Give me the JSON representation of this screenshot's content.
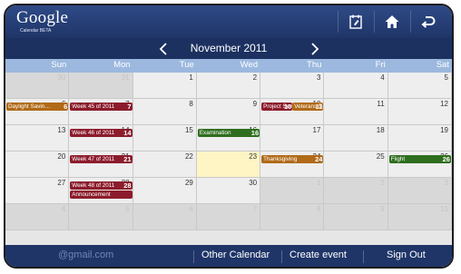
{
  "app": {
    "logo_text": "Google",
    "logo_sub": "Calendar BETA"
  },
  "toolbar": {
    "icons": [
      "edit-calendar-icon",
      "home-icon",
      "back-icon"
    ]
  },
  "calendar": {
    "month_label": "November 2011",
    "weekdays": [
      "Sun",
      "Mon",
      "Tue",
      "Wed",
      "Thu",
      "Fri",
      "Sat"
    ],
    "weeks": [
      [
        {
          "d": "30",
          "o": true
        },
        {
          "d": "31",
          "o": true
        },
        {
          "d": "1"
        },
        {
          "d": "2"
        },
        {
          "d": "3"
        },
        {
          "d": "4"
        },
        {
          "d": "5"
        }
      ],
      [
        {
          "d": "6"
        },
        {
          "d": "7"
        },
        {
          "d": "8"
        },
        {
          "d": "9"
        },
        {
          "d": "10"
        },
        {
          "d": "11"
        },
        {
          "d": "12"
        }
      ],
      [
        {
          "d": "13"
        },
        {
          "d": "14"
        },
        {
          "d": "15"
        },
        {
          "d": "16"
        },
        {
          "d": "17"
        },
        {
          "d": "18"
        },
        {
          "d": "19"
        }
      ],
      [
        {
          "d": "20"
        },
        {
          "d": "21"
        },
        {
          "d": "22"
        },
        {
          "d": "23",
          "t": true
        },
        {
          "d": "24"
        },
        {
          "d": "25"
        },
        {
          "d": "26"
        }
      ],
      [
        {
          "d": "27"
        },
        {
          "d": "28"
        },
        {
          "d": "29"
        },
        {
          "d": "30"
        },
        {
          "d": "1",
          "o": true
        },
        {
          "d": "2",
          "o": true
        },
        {
          "d": "3",
          "o": true
        }
      ],
      [
        {
          "d": "4",
          "o": true
        },
        {
          "d": "5",
          "o": true
        },
        {
          "d": "6",
          "o": true
        },
        {
          "d": "7",
          "o": true
        },
        {
          "d": "8",
          "o": true
        },
        {
          "d": "9",
          "o": true
        },
        {
          "d": "10",
          "o": true
        }
      ]
    ],
    "events": [
      {
        "title": "Daylight Savin…",
        "count": "6",
        "week": 1,
        "day": 0,
        "color": "#b06a18"
      },
      {
        "title": "Week 45 of 2011",
        "count": "7",
        "week": 1,
        "day": 1,
        "color": "#8c1c2c"
      },
      {
        "title": "Project Seminar",
        "count": "10",
        "week": 1,
        "day": 4,
        "color": "#8c1c2c",
        "half": "left"
      },
      {
        "title": "Veterans Day",
        "count": "11",
        "week": 1,
        "day": 4,
        "color": "#b06a18",
        "half": "right"
      },
      {
        "title": "Week 46 of 2011",
        "count": "14",
        "week": 2,
        "day": 1,
        "color": "#8c1c2c"
      },
      {
        "title": "Examination",
        "count": "16",
        "week": 2,
        "day": 3,
        "color": "#2f6e1e"
      },
      {
        "title": "Week 47 of 2011",
        "count": "21",
        "week": 3,
        "day": 1,
        "color": "#8c1c2c"
      },
      {
        "title": "Thanksgiving",
        "count": "24",
        "week": 3,
        "day": 4,
        "color": "#b06a18"
      },
      {
        "title": "Flight",
        "count": "26",
        "week": 3,
        "day": 6,
        "color": "#2f6e1e"
      },
      {
        "title": "Week 48 of 2011",
        "count": "28",
        "week": 4,
        "day": 1,
        "color": "#8c1c2c"
      },
      {
        "title": "Announcement",
        "count": "",
        "week": 4,
        "day": 1,
        "color": "#8c1c2c",
        "row": 2
      }
    ]
  },
  "footer": {
    "account": "@gmail.com",
    "other_calendar": "Other Calendar",
    "create_event": "Create event",
    "sign_out": "Sign Out"
  }
}
